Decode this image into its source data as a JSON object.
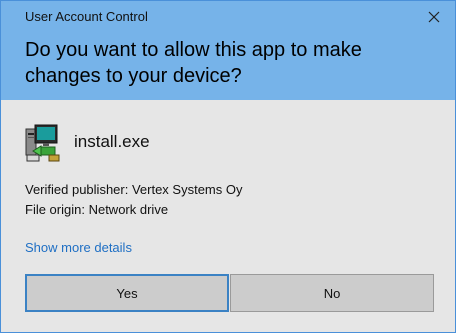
{
  "window": {
    "title": "User Account Control",
    "close_icon": "close-icon"
  },
  "prompt": {
    "question": "Do you want to allow this app to make changes to your device?"
  },
  "app": {
    "icon": "installer-icon",
    "name": "install.exe",
    "publisher": "Verified publisher: Vertex Systems Oy",
    "origin": "File origin: Network drive",
    "details_link": "Show more details"
  },
  "buttons": {
    "yes": "Yes",
    "no": "No"
  },
  "colors": {
    "header_bg": "#76b3e9",
    "body_bg": "#e6e6e6",
    "link": "#1f6fc4",
    "button_bg": "#cccccc",
    "focus_border": "#3b82c4"
  }
}
